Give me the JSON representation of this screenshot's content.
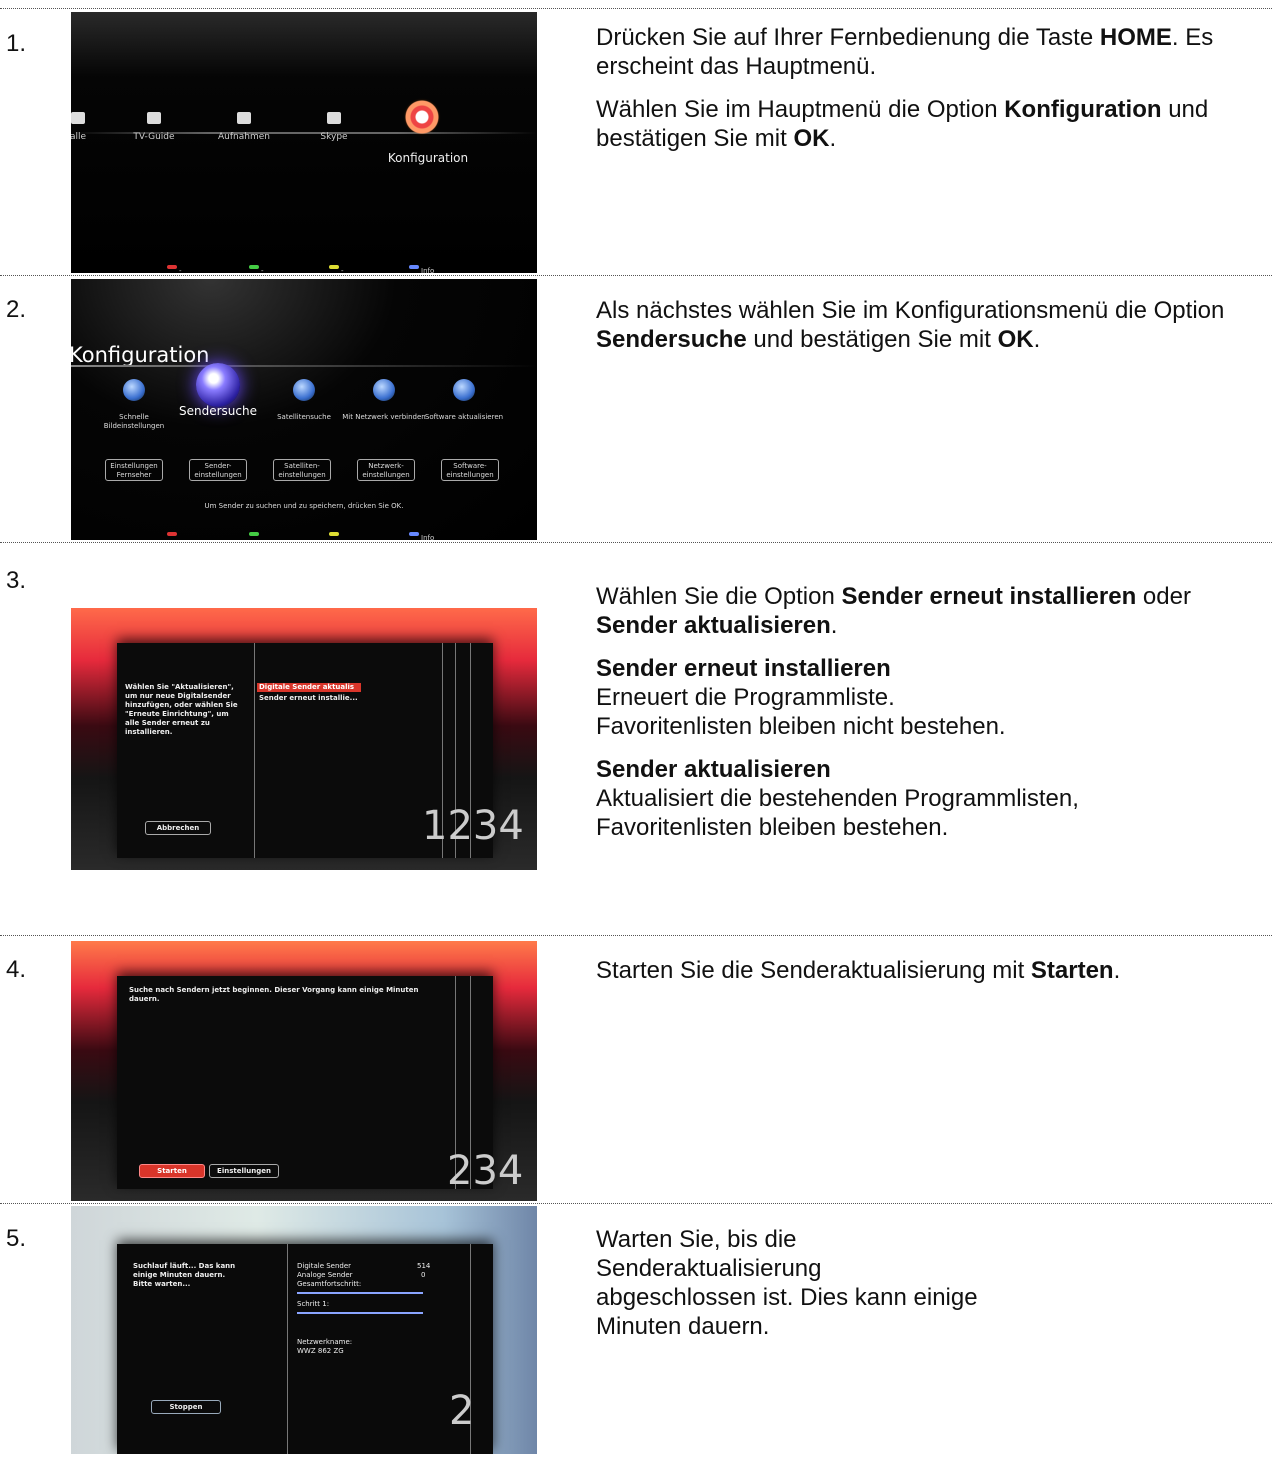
{
  "steps": [
    {
      "number": "1.",
      "screen": {
        "items": [
          "TV-Guide",
          "Aufnahmen",
          "Skype"
        ],
        "selected": "Konfiguration",
        "left_label": "alle",
        "footer": [
          "-",
          "-",
          "-",
          "Info"
        ]
      },
      "text": {
        "p1_before": "Drücken Sie auf Ihrer Fernbedienung die Taste ",
        "p1_bold": "HOME",
        "p1_after": ". Es erscheint das Hauptmenü.",
        "p2_before": "Wählen Sie im Hauptmenü die Option ",
        "p2_bold1": "Konfiguration",
        "p2_mid": " und bestätigen Sie mit ",
        "p2_bold2": "OK",
        "p2_after": "."
      }
    },
    {
      "number": "2.",
      "screen": {
        "title": "Konfiguration",
        "options": [
          "Schnelle Bildeinstellungen",
          "Sendersuche",
          "Satellitensuche",
          "Mit Netzwerk verbinden",
          "Software aktualisieren"
        ],
        "buttons": [
          "Einstellungen Fernseher",
          "Sender-einstellungen",
          "Satelliten-einstellungen",
          "Netzwerk-einstellungen",
          "Software-einstellungen"
        ],
        "hint": "Um Sender zu suchen und zu speichern, drücken Sie OK.",
        "footer": [
          "-",
          "-",
          "-",
          "Info"
        ]
      },
      "text": {
        "before": "Als nächstes wählen Sie im Konfigurationsmenü die Option ",
        "bold1": "Sendersuche",
        "mid": " und bestätigen Sie mit ",
        "bold2": "OK",
        "after": "."
      }
    },
    {
      "number": "3.",
      "screen": {
        "info": "Wählen Sie \"Aktualisieren\", um nur neue Digitalsender hinzufügen, oder wählen Sie \"Erneute Einrichtung\", um alle Sender erneut zu installieren.",
        "opt1": "Digitale Sender aktualis",
        "opt2": "Sender erneut installie...",
        "button": "Abbrechen",
        "digits": "1234"
      },
      "text": {
        "intro_before": "Wählen Sie die Option ",
        "intro_bold1": "Sender erneut installieren",
        "intro_mid": " oder ",
        "intro_bold2": "Sender aktualisieren",
        "intro_after": ".",
        "h1": "Sender erneut installieren",
        "h1_line1": "Erneuert die Programmliste.",
        "h1_line2": "Favoritenlisten bleiben nicht bestehen.",
        "h2": "Sender aktualisieren",
        "h2_line1": "Aktualisiert die bestehenden Programmlisten,",
        "h2_line2": "Favoritenlisten bleiben bestehen."
      }
    },
    {
      "number": "4.",
      "screen": {
        "info": "Suche nach Sendern jetzt beginnen. Dieser Vorgang kann einige Minuten dauern.",
        "btn_start": "Starten",
        "btn_settings": "Einstellungen",
        "digits": "234"
      },
      "text": {
        "before": "Starten Sie die Senderaktualisierung mit ",
        "bold": "Starten",
        "after": "."
      }
    },
    {
      "number": "5.",
      "screen": {
        "info": "Suchlauf läuft... Das kann einige Minuten dauern. Bitte warten...",
        "digital_label": "Digitale Sender",
        "digital_value": "514",
        "analog_label": "Analoge Sender",
        "analog_value": "0",
        "progress_label": "Gesamtfortschritt:",
        "step_label": "Schritt 1:",
        "network_label": "Netzwerkname:",
        "network_value": "WWZ 862 ZG",
        "button": "Stoppen",
        "digits": "2"
      },
      "text": {
        "line": "Warten Sie, bis die Senderaktualisierung abgeschlossen ist. Dies kann einige Minuten dauern."
      }
    }
  ]
}
